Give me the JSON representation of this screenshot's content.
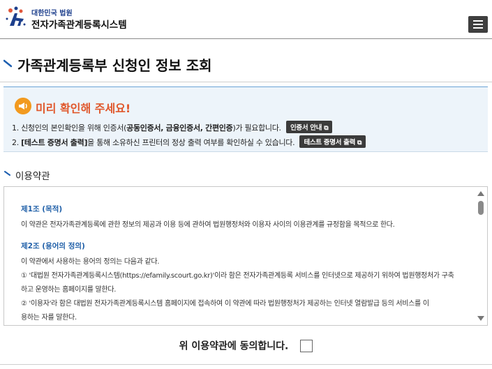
{
  "header": {
    "org_name": "대한민국 법원",
    "system_name": "전자가족관계등록시스템",
    "menu_icon": "hamburger-menu-icon"
  },
  "page": {
    "title": "가족관계등록부 신청인 정보 조회"
  },
  "notice": {
    "icon": "megaphone-icon",
    "title": "미리 확인해 주세요!",
    "line1_prefix": "1. 신청인의 본인확인을 위해 인증서(",
    "line1_bold": "공동인증서, 금융인증서, 간편인증",
    "line1_suffix": ")가 필요합니다.",
    "cert_button_label": "인증서 안내",
    "line2_prefix": "2. ",
    "line2_bold": "[테스트 증명서 출력]",
    "line2_suffix": "을 통해 소유하신 프린터의 정상 출력 여부를 확인하실 수 있습니다.",
    "test_button_label": "테스트 증명서 출력",
    "external_link_icon": "external-link-icon",
    "colors": {
      "background": "#edf4fa",
      "title": "#e0572b",
      "icon": "#f29a1f"
    }
  },
  "terms": {
    "section_title": "이용약관",
    "article1_heading": "제1조 (목적)",
    "article1_text": "이 약관은 전자가족관계등록에 관한 정보의 제공과 이용 등에 관하여 법원행정처와 이용자 사이의 이용관계를 규정함을 목적으로 한다.",
    "article2_heading": "제2조 (용어의 정의)",
    "article2_intro": "이 약관에서 사용하는 용어의 정의는 다음과 같다.",
    "article2_item1_line1": "① '대법원 전자가족관계등록시스템(https://efamily.scourt.go.kr)'이라 함은 전자가족관계등록 서비스를 인터넷으로 제공하기 위하여 법원행정처가 구축",
    "article2_item1_line2": "하고 운영하는 홈페이지를 말한다.",
    "article2_item2_line1": "② '이용자'라 함은 대법원 전자가족관계등록시스템 홈페이지에 접속하여 이 약관에 따라 법원행정처가 제공하는 인터넷 열람발급 등의 서비스를 이",
    "article2_item2_line2": "용하는 자를 말한다."
  },
  "agreement": {
    "label": "위 이용약관에 동의합니다.",
    "checked": false
  }
}
